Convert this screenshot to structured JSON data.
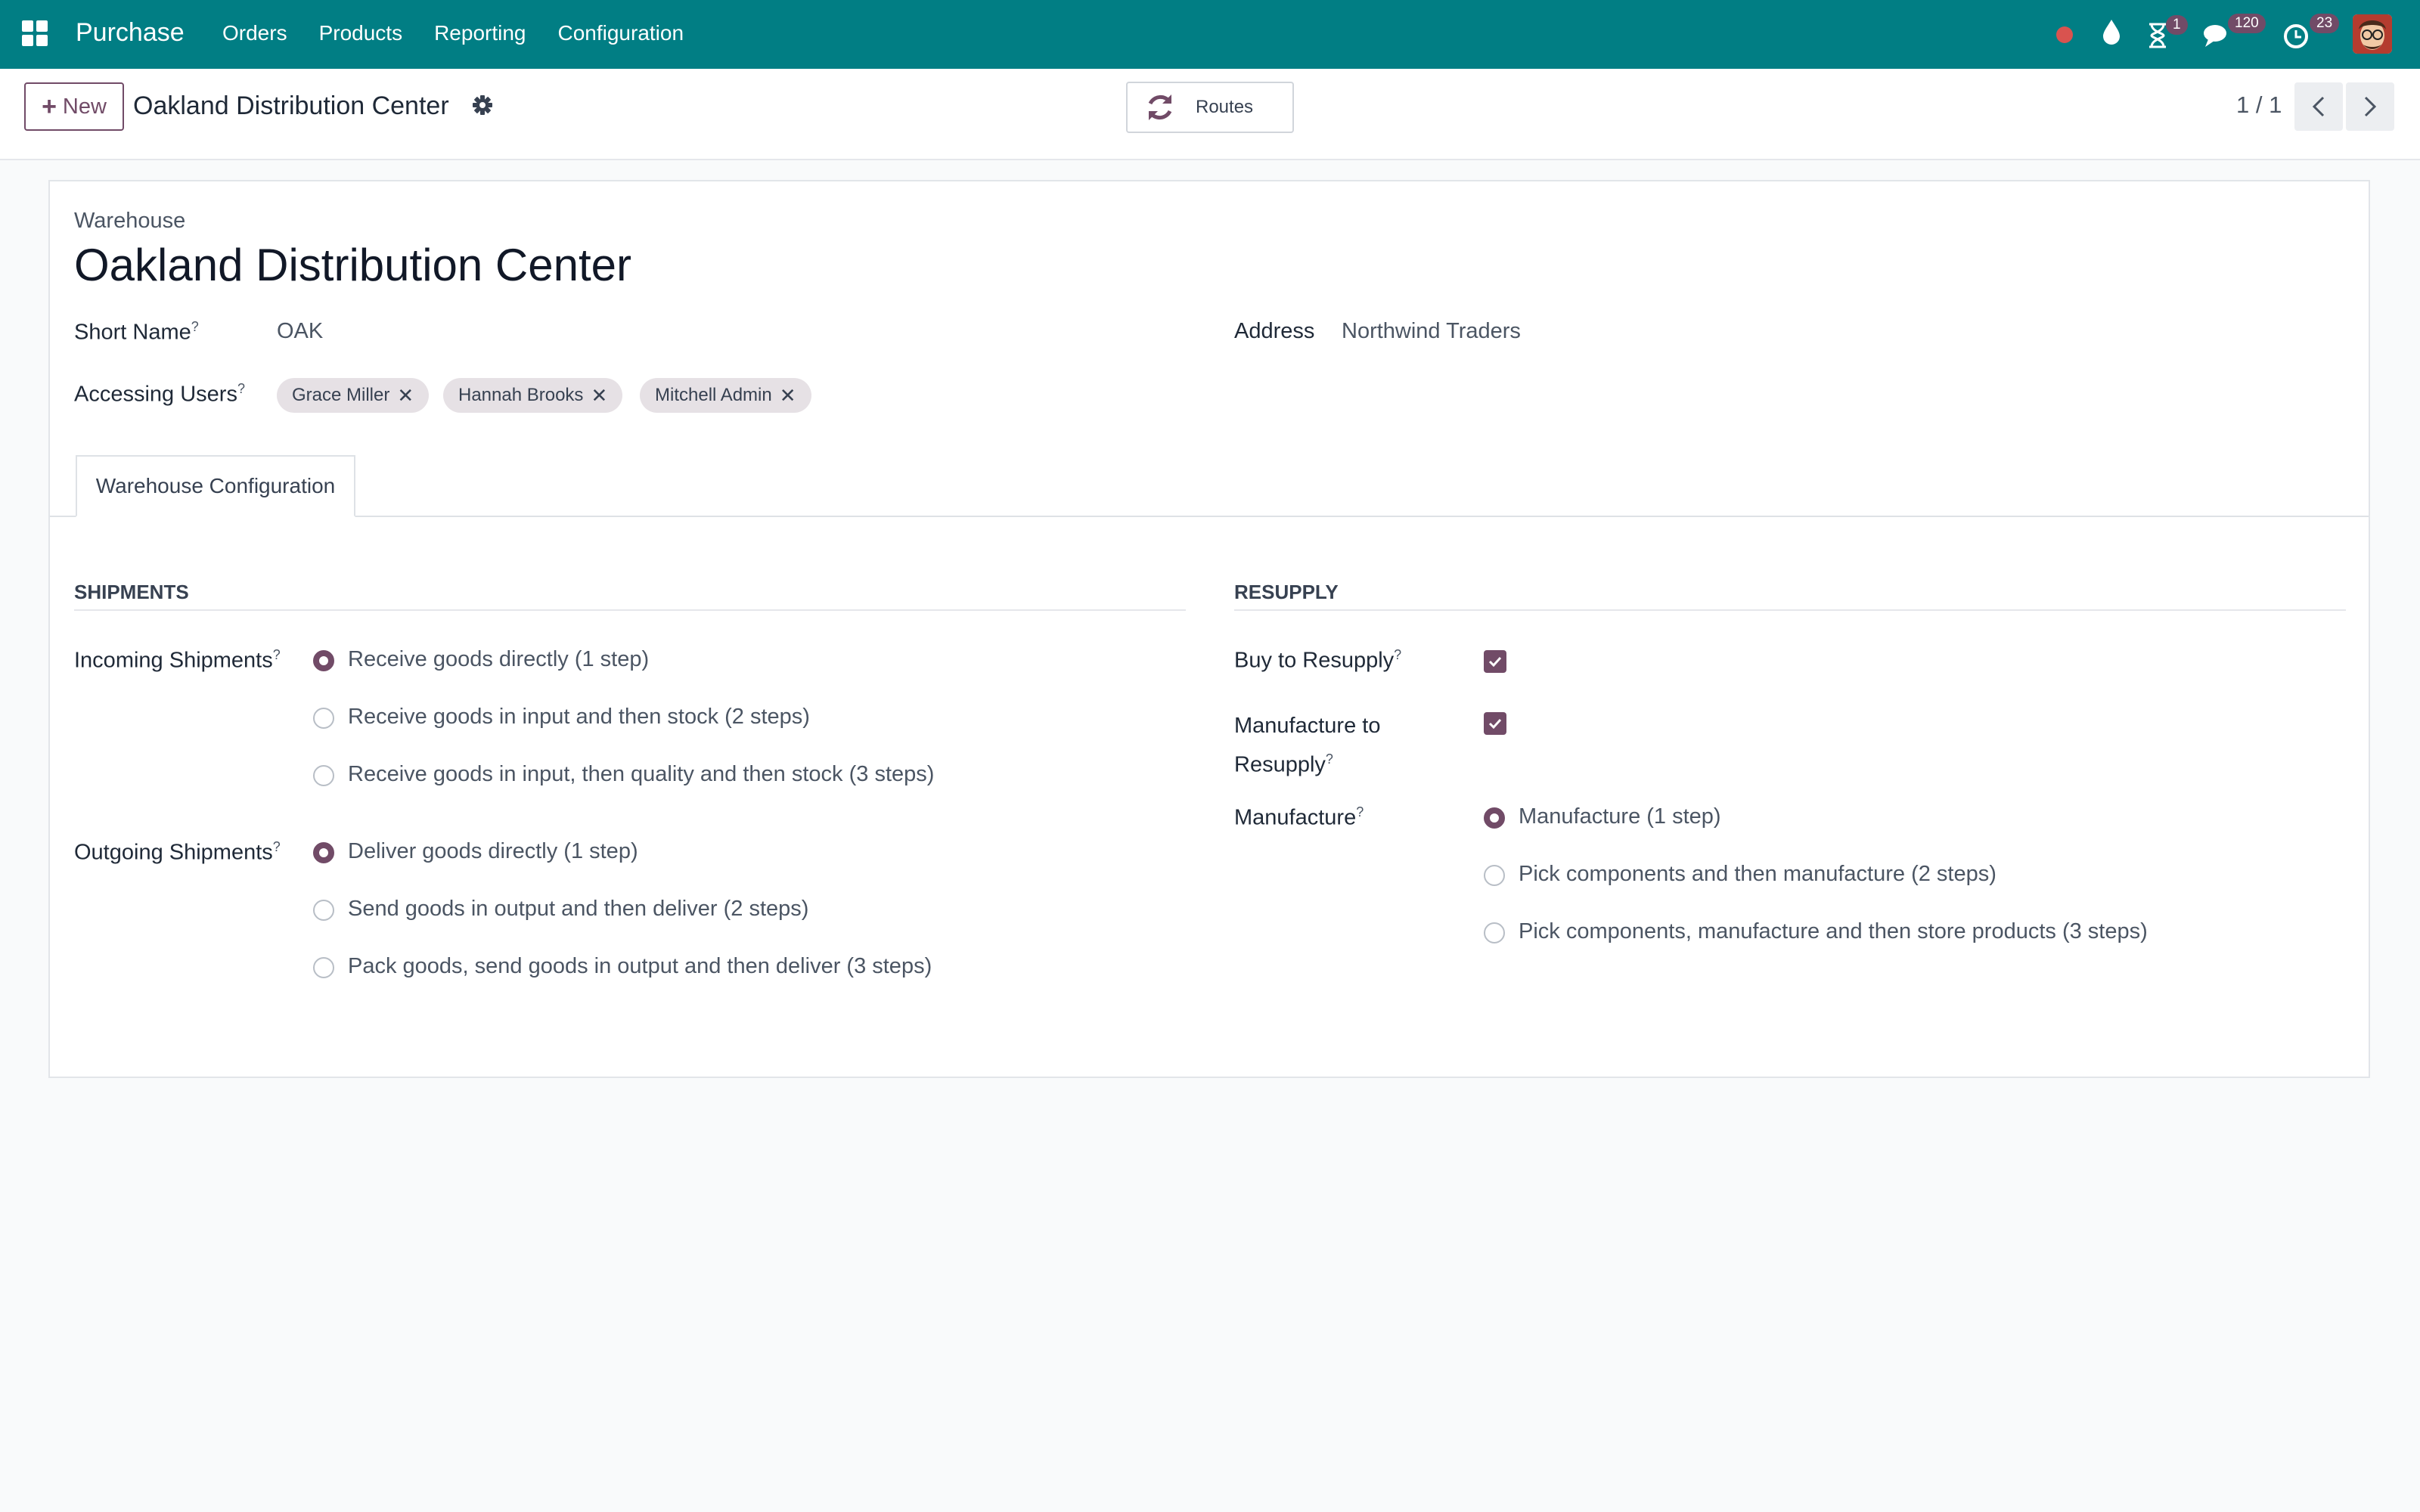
{
  "navbar": {
    "app_name": "Purchase",
    "menu": [
      "Orders",
      "Products",
      "Reporting",
      "Configuration"
    ],
    "activity_badge": "1",
    "messages_badge": "120",
    "activities_badge": "23"
  },
  "control_panel": {
    "new_label": "New",
    "record_title": "Oakland Distribution Center",
    "routes_label": "Routes",
    "pager": "1 / 1"
  },
  "form": {
    "model_label": "Warehouse",
    "name": "Oakland Distribution Center",
    "short_name_label": "Short Name",
    "short_name": "OAK",
    "address_label": "Address",
    "address": "Northwind Traders",
    "accessing_users_label": "Accessing Users",
    "accessing_users": [
      "Grace Miller",
      "Hannah Brooks",
      "Mitchell Admin"
    ],
    "help_mark": "?",
    "tab_label": "Warehouse Configuration"
  },
  "shipments": {
    "title": "SHIPMENTS",
    "incoming_label": "Incoming Shipments",
    "incoming_options": [
      "Receive goods directly (1 step)",
      "Receive goods in input and then stock (2 steps)",
      "Receive goods in input, then quality and then stock (3 steps)"
    ],
    "incoming_selected": 0,
    "outgoing_label": "Outgoing Shipments",
    "outgoing_options": [
      "Deliver goods directly (1 step)",
      "Send goods in output and then deliver (2 steps)",
      "Pack goods, send goods in output and then deliver (3 steps)"
    ],
    "outgoing_selected": 0
  },
  "resupply": {
    "title": "RESUPPLY",
    "buy_label": "Buy to Resupply",
    "buy_checked": true,
    "manufacture_resupply_label_1": "Manufacture to",
    "manufacture_resupply_label_2": "Resupply",
    "manufacture_resupply_checked": true,
    "manufacture_label": "Manufacture",
    "manufacture_options": [
      "Manufacture (1 step)",
      "Pick components and then manufacture (2 steps)",
      "Pick components, manufacture and then store products (3 steps)"
    ],
    "manufacture_selected": 0
  },
  "colors": {
    "navbar": "#017e84",
    "accent": "#714b67",
    "badge": "#714b67",
    "recording_dot": "#d9534f"
  }
}
